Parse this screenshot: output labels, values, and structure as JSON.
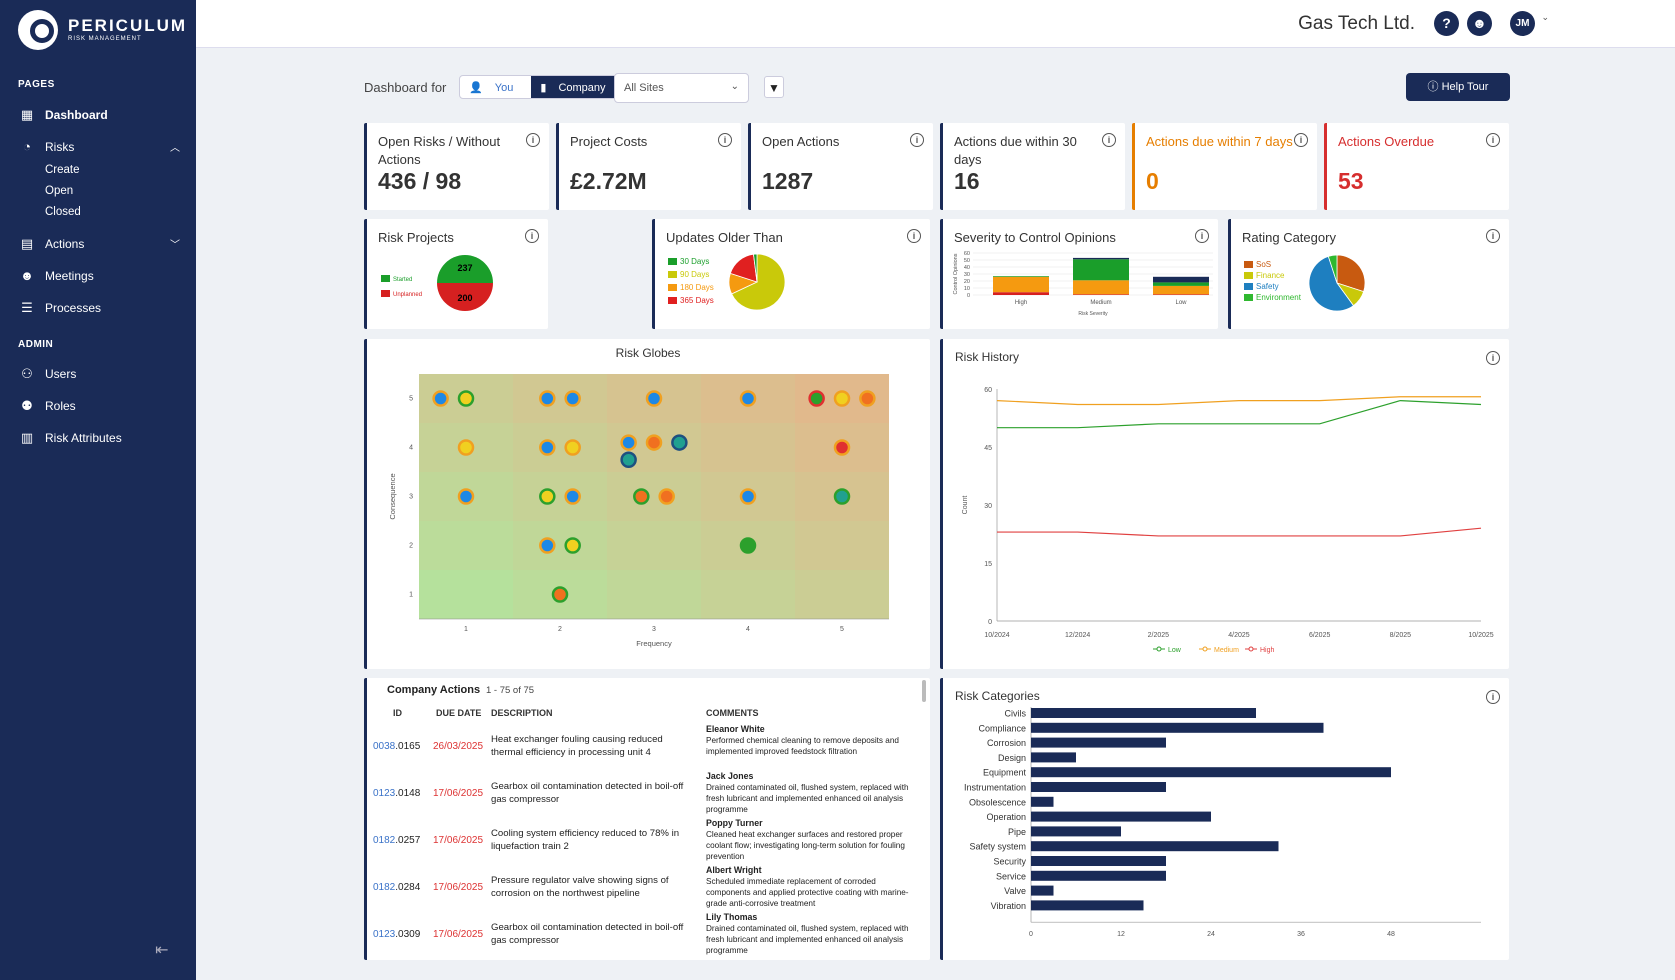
{
  "brand": {
    "name": "PERICULUM",
    "sub": "RISK MANAGEMENT"
  },
  "sidebar": {
    "pages_title": "PAGES",
    "admin_title": "ADMIN",
    "dashboard": "Dashboard",
    "risks": "Risks",
    "risks_sub": [
      "Create",
      "Open",
      "Closed"
    ],
    "actions": "Actions",
    "meetings": "Meetings",
    "processes": "Processes",
    "users": "Users",
    "roles": "Roles",
    "risk_attributes": "Risk Attributes"
  },
  "header": {
    "company": "Gas Tech Ltd.",
    "avatar": "JM"
  },
  "filters": {
    "dashboard_for": "Dashboard for",
    "you": "You",
    "company": "Company",
    "site": "All Sites",
    "help": "Help Tour"
  },
  "kpis": [
    {
      "title": "Open Risks / Without Actions",
      "value": "436 / 98",
      "color": "#1a2b57",
      "text_color": "#333"
    },
    {
      "title": "Project Costs",
      "value": "£2.72M",
      "color": "#1a2b57",
      "text_color": "#333"
    },
    {
      "title": "Open Actions",
      "value": "1287",
      "color": "#1a2b57",
      "text_color": "#333"
    },
    {
      "title": "Actions due within 30 days",
      "value": "16",
      "color": "#1a2b57",
      "text_color": "#333"
    },
    {
      "title": "Actions due within 7 days",
      "value": "0",
      "color": "#e67e00",
      "text_color": "#e67e00"
    },
    {
      "title": "Actions Overdue",
      "value": "53",
      "color": "#d62e2e",
      "text_color": "#d62e2e"
    }
  ],
  "risk_projects": {
    "title": "Risk Projects",
    "legend": [
      "Started",
      "Unplanned"
    ],
    "colors": [
      "#1a9e2a",
      "#d62020"
    ],
    "values": [
      237,
      200
    ]
  },
  "updates_older": {
    "title": "Updates Older Than",
    "legend": [
      "30 Days",
      "90 Days",
      "180 Days",
      "365 Days"
    ],
    "colors": [
      "#1a9e2a",
      "#c9c90a",
      "#f59a10",
      "#e02020"
    ],
    "shares": [
      0.02,
      0.68,
      0.12,
      0.18
    ]
  },
  "severity": {
    "title": "Severity to Control Opinions",
    "ylabel": "Control Opinions",
    "xlabel": "Risk Severity",
    "yticks": [
      0,
      10,
      20,
      30,
      40,
      50,
      60
    ],
    "categories": [
      "High",
      "Medium",
      "Low"
    ]
  },
  "rating": {
    "title": "Rating Category",
    "legend": [
      "SoS",
      "Finance",
      "Safety",
      "Environment"
    ],
    "colors": [
      "#c85a10",
      "#c9c90a",
      "#1e7fc0",
      "#2fb82f"
    ],
    "shares": [
      0.3,
      0.1,
      0.55,
      0.05
    ]
  },
  "chart_data": [
    {
      "type": "scatter",
      "title": "Risk Globes",
      "xlabel": "Frequency",
      "ylabel": "Consequence",
      "xticks": [
        1,
        2,
        3,
        4,
        5
      ],
      "yticks": [
        1,
        2,
        3,
        4,
        5
      ]
    },
    {
      "type": "line",
      "title": "Risk History",
      "ylabel": "Count",
      "x": [
        "10/2024",
        "12/2024",
        "2/2025",
        "4/2025",
        "6/2025",
        "8/2025",
        "10/2025"
      ],
      "ylim": [
        0,
        60
      ],
      "yticks": [
        0,
        15,
        30,
        45,
        60
      ],
      "series": [
        {
          "name": "Low",
          "color": "#2ca02c",
          "values": [
            50,
            50,
            51,
            51,
            51,
            57,
            56
          ]
        },
        {
          "name": "Medium",
          "color": "#f0a020",
          "values": [
            57,
            56,
            56,
            57,
            57,
            58,
            58
          ]
        },
        {
          "name": "High",
          "color": "#e04040",
          "values": [
            23,
            23,
            22,
            22,
            22,
            22,
            24
          ]
        }
      ]
    },
    {
      "type": "bar",
      "title": "Risk Categories",
      "categories": [
        "Civils",
        "Compliance",
        "Corrosion",
        "Design",
        "Equipment",
        "Instrumentation",
        "Obsolescence",
        "Operation",
        "Pipe",
        "Safety system",
        "Security",
        "Service",
        "Valve",
        "Vibration"
      ],
      "values": [
        30,
        39,
        18,
        6,
        48,
        18,
        3,
        24,
        12,
        33,
        18,
        18,
        3,
        15
      ],
      "xticks": [
        0,
        12,
        24,
        36,
        48
      ],
      "xlim": [
        0,
        60
      ]
    }
  ],
  "severity_data": {
    "type": "bar",
    "stacked": true,
    "categories": [
      "High",
      "Medium",
      "Low"
    ],
    "series": [
      {
        "color": "#d62020",
        "values": [
          4,
          1,
          1
        ]
      },
      {
        "color": "#f59a10",
        "values": [
          22,
          20,
          12
        ]
      },
      {
        "color": "#1a9e2a",
        "values": [
          1,
          30,
          5
        ]
      },
      {
        "color": "#1a2b57",
        "values": [
          0,
          2,
          8
        ]
      }
    ]
  },
  "actions": {
    "title": "Company Actions",
    "range": "1 - 75 of 75",
    "headers": [
      "ID",
      "DUE DATE",
      "DESCRIPTION",
      "COMMENTS"
    ],
    "rows": [
      {
        "id_a": "0038",
        "id_b": ".0165",
        "date": "26/03/2025",
        "desc": "Heat exchanger fouling causing reduced thermal efficiency in processing unit 4",
        "who": "Eleanor White",
        "comment": "Performed chemical cleaning to remove deposits and implemented improved feedstock filtration"
      },
      {
        "id_a": "0123",
        "id_b": ".0148",
        "date": "17/06/2025",
        "desc": "Gearbox oil contamination detected in boil-off gas compressor",
        "who": "Jack Jones",
        "comment": "Drained contaminated oil, flushed system, replaced with fresh lubricant and implemented enhanced oil analysis programme"
      },
      {
        "id_a": "0182",
        "id_b": ".0257",
        "date": "17/06/2025",
        "desc": "Cooling system efficiency reduced to 78% in liquefaction train 2",
        "who": "Poppy Turner",
        "comment": "Cleaned heat exchanger surfaces and restored proper coolant flow; investigating long-term solution for fouling prevention"
      },
      {
        "id_a": "0182",
        "id_b": ".0284",
        "date": "17/06/2025",
        "desc": "Pressure regulator valve showing signs of corrosion on the northwest pipeline",
        "who": "Albert Wright",
        "comment": "Scheduled immediate replacement of corroded components and applied protective coating with marine-grade anti-corrosive treatment"
      },
      {
        "id_a": "0123",
        "id_b": ".0309",
        "date": "17/06/2025",
        "desc": "Gearbox oil contamination detected in boil-off gas compressor",
        "who": "Lily Thomas",
        "comment": "Drained contaminated oil, flushed system, replaced with fresh lubricant and implemented enhanced oil analysis programme"
      }
    ]
  }
}
